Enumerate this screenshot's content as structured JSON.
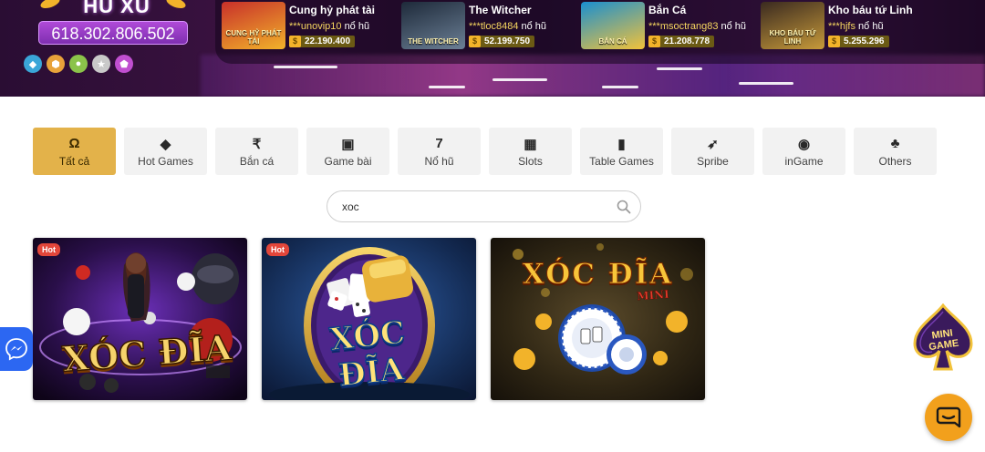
{
  "jackpot": {
    "title": "HŨ XU",
    "amount": "618.302.806.502",
    "gem_colors": [
      "#3aa6d8",
      "#e8a33a",
      "#8bc34a",
      "#f5f5f5",
      "#c04fd0"
    ]
  },
  "recent_winners": [
    {
      "game": "Cung hỷ phát tài",
      "user": "***unovip10",
      "suffix": "nổ hũ",
      "prize": "22.190.400",
      "thumb_text": "CUNG HỶ PHÁT TÀI",
      "thumb_colors": [
        "#c8302a",
        "#f2b32a"
      ]
    },
    {
      "game": "The Witcher",
      "user": "***tloc8484",
      "suffix": "nổ hũ",
      "prize": "52.199.750",
      "thumb_text": "THE WITCHER",
      "thumb_colors": [
        "#1e2a3a",
        "#6b7f95"
      ]
    },
    {
      "game": "Bắn Cá",
      "user": "***msoctrang83",
      "suffix": "nổ hũ",
      "prize": "21.208.778",
      "thumb_text": "BẮN CÁ",
      "thumb_colors": [
        "#1a8fd0",
        "#f2c23a"
      ]
    },
    {
      "game": "Kho báu tứ Linh",
      "user": "***hjfs",
      "suffix": "nổ hũ",
      "prize": "5.255.296",
      "thumb_text": "KHO BÁU TỨ LINH",
      "thumb_colors": [
        "#3a2a20",
        "#c79a3a"
      ]
    }
  ],
  "categories": [
    {
      "label": "Tất cả",
      "icon": "omega-icon",
      "glyph": "Ω",
      "active": true
    },
    {
      "label": "Hot Games",
      "icon": "diamond-icon",
      "glyph": "◆",
      "active": false
    },
    {
      "label": "Bắn cá",
      "icon": "rupee-icon",
      "glyph": "₹",
      "active": false
    },
    {
      "label": "Game bài",
      "icon": "cards-icon",
      "glyph": "▣",
      "active": false
    },
    {
      "label": "Nổ hũ",
      "icon": "seven-icon",
      "glyph": "7",
      "active": false
    },
    {
      "label": "Slots",
      "icon": "slot-machine-icon",
      "glyph": "▦",
      "active": false
    },
    {
      "label": "Table Games",
      "icon": "card-table-icon",
      "glyph": "▮",
      "active": false
    },
    {
      "label": "Spribe",
      "icon": "rocket-icon",
      "glyph": "➶",
      "active": false
    },
    {
      "label": "inGame",
      "icon": "chip-icon",
      "glyph": "◉",
      "active": false
    },
    {
      "label": "Others",
      "icon": "cherries-icon",
      "glyph": "♣",
      "active": false
    }
  ],
  "search": {
    "value": "xoc",
    "placeholder": ""
  },
  "games": [
    {
      "title": "XÓC ĐĨA",
      "badge": "Hot",
      "style": "live"
    },
    {
      "title": "XÓC ĐĨA",
      "badge": "Hot",
      "style": "classic"
    },
    {
      "title": "XÓC ĐĨA",
      "subtitle": "MINI",
      "badge": "",
      "style": "mini"
    }
  ],
  "floating": {
    "minigame_label": "MINI GAME"
  },
  "colors": {
    "accent": "#e3b24a",
    "hot_badge": "#e2463a",
    "chat": "#f2a01c",
    "messenger": "#2c67f2"
  }
}
